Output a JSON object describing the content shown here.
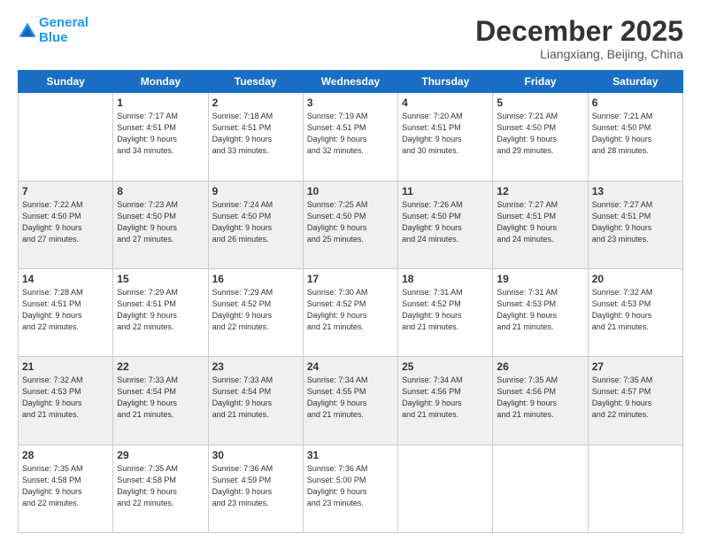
{
  "logo": {
    "line1": "General",
    "line2": "Blue"
  },
  "title": "December 2025",
  "subtitle": "Liangxiang, Beijing, China",
  "headers": [
    "Sunday",
    "Monday",
    "Tuesday",
    "Wednesday",
    "Thursday",
    "Friday",
    "Saturday"
  ],
  "weeks": [
    [
      {
        "day": "",
        "info": ""
      },
      {
        "day": "1",
        "info": "Sunrise: 7:17 AM\nSunset: 4:51 PM\nDaylight: 9 hours\nand 34 minutes."
      },
      {
        "day": "2",
        "info": "Sunrise: 7:18 AM\nSunset: 4:51 PM\nDaylight: 9 hours\nand 33 minutes."
      },
      {
        "day": "3",
        "info": "Sunrise: 7:19 AM\nSunset: 4:51 PM\nDaylight: 9 hours\nand 32 minutes."
      },
      {
        "day": "4",
        "info": "Sunrise: 7:20 AM\nSunset: 4:51 PM\nDaylight: 9 hours\nand 30 minutes."
      },
      {
        "day": "5",
        "info": "Sunrise: 7:21 AM\nSunset: 4:50 PM\nDaylight: 9 hours\nand 29 minutes."
      },
      {
        "day": "6",
        "info": "Sunrise: 7:21 AM\nSunset: 4:50 PM\nDaylight: 9 hours\nand 28 minutes."
      }
    ],
    [
      {
        "day": "7",
        "info": "Sunrise: 7:22 AM\nSunset: 4:50 PM\nDaylight: 9 hours\nand 27 minutes."
      },
      {
        "day": "8",
        "info": "Sunrise: 7:23 AM\nSunset: 4:50 PM\nDaylight: 9 hours\nand 27 minutes."
      },
      {
        "day": "9",
        "info": "Sunrise: 7:24 AM\nSunset: 4:50 PM\nDaylight: 9 hours\nand 26 minutes."
      },
      {
        "day": "10",
        "info": "Sunrise: 7:25 AM\nSunset: 4:50 PM\nDaylight: 9 hours\nand 25 minutes."
      },
      {
        "day": "11",
        "info": "Sunrise: 7:26 AM\nSunset: 4:50 PM\nDaylight: 9 hours\nand 24 minutes."
      },
      {
        "day": "12",
        "info": "Sunrise: 7:27 AM\nSunset: 4:51 PM\nDaylight: 9 hours\nand 24 minutes."
      },
      {
        "day": "13",
        "info": "Sunrise: 7:27 AM\nSunset: 4:51 PM\nDaylight: 9 hours\nand 23 minutes."
      }
    ],
    [
      {
        "day": "14",
        "info": "Sunrise: 7:28 AM\nSunset: 4:51 PM\nDaylight: 9 hours\nand 22 minutes."
      },
      {
        "day": "15",
        "info": "Sunrise: 7:29 AM\nSunset: 4:51 PM\nDaylight: 9 hours\nand 22 minutes."
      },
      {
        "day": "16",
        "info": "Sunrise: 7:29 AM\nSunset: 4:52 PM\nDaylight: 9 hours\nand 22 minutes."
      },
      {
        "day": "17",
        "info": "Sunrise: 7:30 AM\nSunset: 4:52 PM\nDaylight: 9 hours\nand 21 minutes."
      },
      {
        "day": "18",
        "info": "Sunrise: 7:31 AM\nSunset: 4:52 PM\nDaylight: 9 hours\nand 21 minutes."
      },
      {
        "day": "19",
        "info": "Sunrise: 7:31 AM\nSunset: 4:53 PM\nDaylight: 9 hours\nand 21 minutes."
      },
      {
        "day": "20",
        "info": "Sunrise: 7:32 AM\nSunset: 4:53 PM\nDaylight: 9 hours\nand 21 minutes."
      }
    ],
    [
      {
        "day": "21",
        "info": "Sunrise: 7:32 AM\nSunset: 4:53 PM\nDaylight: 9 hours\nand 21 minutes."
      },
      {
        "day": "22",
        "info": "Sunrise: 7:33 AM\nSunset: 4:54 PM\nDaylight: 9 hours\nand 21 minutes."
      },
      {
        "day": "23",
        "info": "Sunrise: 7:33 AM\nSunset: 4:54 PM\nDaylight: 9 hours\nand 21 minutes."
      },
      {
        "day": "24",
        "info": "Sunrise: 7:34 AM\nSunset: 4:55 PM\nDaylight: 9 hours\nand 21 minutes."
      },
      {
        "day": "25",
        "info": "Sunrise: 7:34 AM\nSunset: 4:56 PM\nDaylight: 9 hours\nand 21 minutes."
      },
      {
        "day": "26",
        "info": "Sunrise: 7:35 AM\nSunset: 4:56 PM\nDaylight: 9 hours\nand 21 minutes."
      },
      {
        "day": "27",
        "info": "Sunrise: 7:35 AM\nSunset: 4:57 PM\nDaylight: 9 hours\nand 22 minutes."
      }
    ],
    [
      {
        "day": "28",
        "info": "Sunrise: 7:35 AM\nSunset: 4:58 PM\nDaylight: 9 hours\nand 22 minutes."
      },
      {
        "day": "29",
        "info": "Sunrise: 7:35 AM\nSunset: 4:58 PM\nDaylight: 9 hours\nand 22 minutes."
      },
      {
        "day": "30",
        "info": "Sunrise: 7:36 AM\nSunset: 4:59 PM\nDaylight: 9 hours\nand 23 minutes."
      },
      {
        "day": "31",
        "info": "Sunrise: 7:36 AM\nSunset: 5:00 PM\nDaylight: 9 hours\nand 23 minutes."
      },
      {
        "day": "",
        "info": ""
      },
      {
        "day": "",
        "info": ""
      },
      {
        "day": "",
        "info": ""
      }
    ]
  ]
}
